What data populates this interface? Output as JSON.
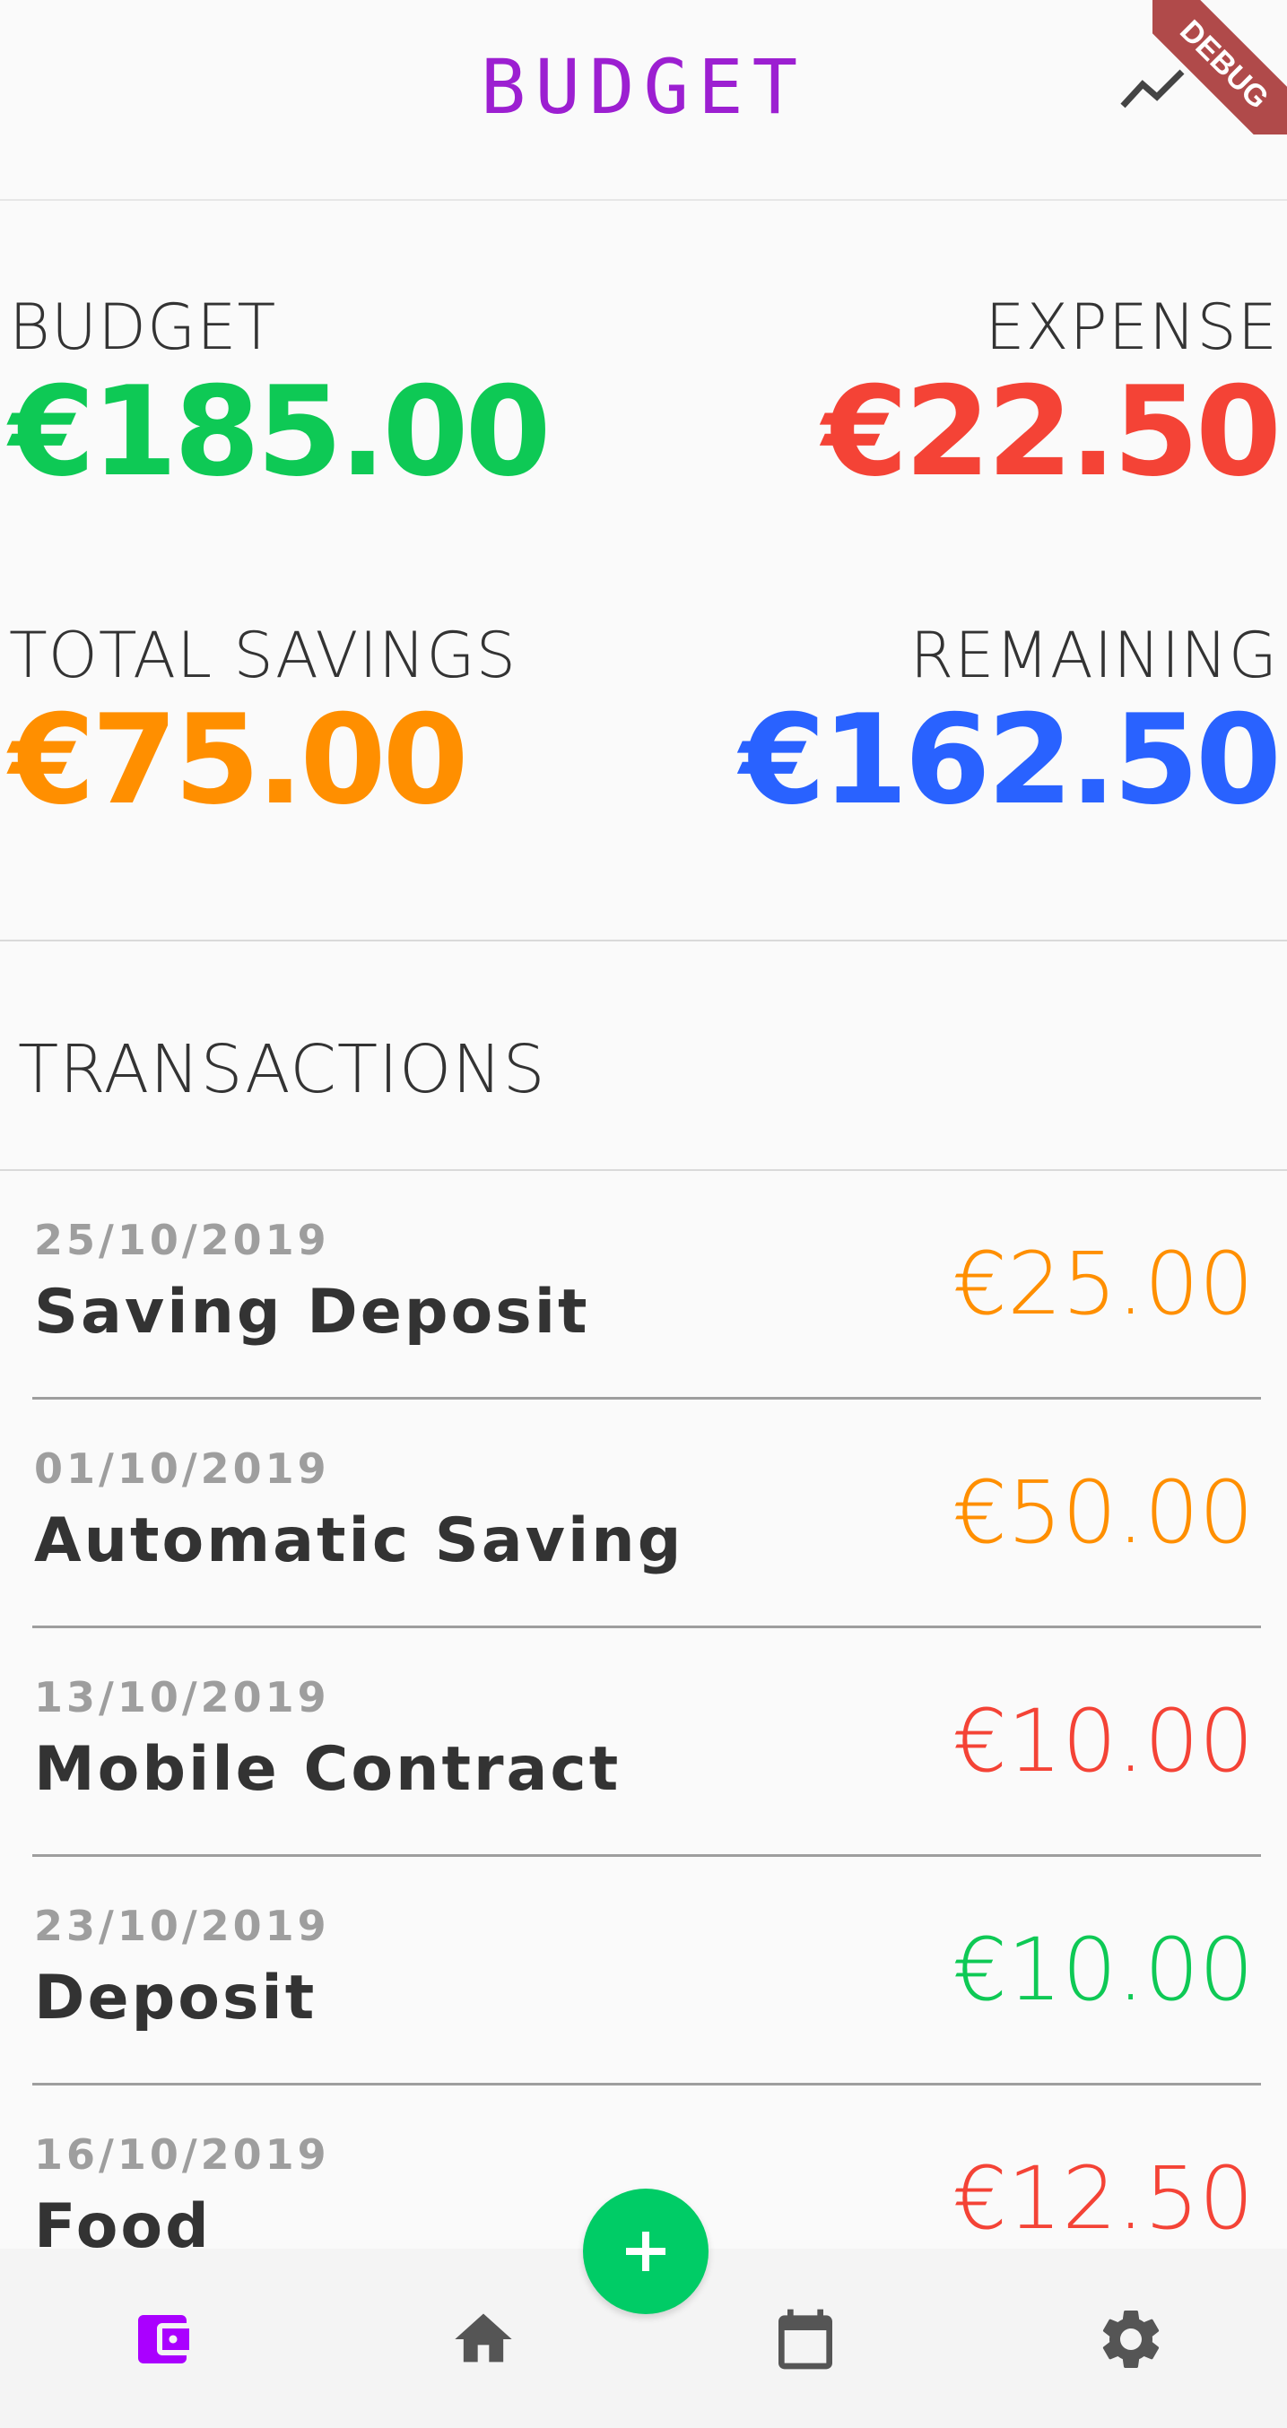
{
  "app_bar": {
    "title": "BUDGET",
    "debug_banner": "DEBUG",
    "chart_icon": "trending-icon"
  },
  "summary": {
    "budget": {
      "label": "BUDGET",
      "value": "€185.00",
      "color": "#0ec955"
    },
    "expense": {
      "label": "EXPENSE",
      "value": "€22.50",
      "color": "#f44336"
    },
    "savings": {
      "label": "TOTAL SAVINGS",
      "value": "€75.00",
      "color": "#ff8f00"
    },
    "remaining": {
      "label": "REMAINING",
      "value": "€162.50",
      "color": "#2962ff"
    }
  },
  "transactions": {
    "title": "TRANSACTIONS",
    "items": [
      {
        "date": "25/10/2019",
        "name": "Saving Deposit",
        "amount": "€25.00",
        "color": "#ff8f00"
      },
      {
        "date": "01/10/2019",
        "name": "Automatic Saving",
        "amount": "€50.00",
        "color": "#ff8f00"
      },
      {
        "date": "13/10/2019",
        "name": "Mobile Contract",
        "amount": "€10.00",
        "color": "#f44336"
      },
      {
        "date": "23/10/2019",
        "name": "Deposit",
        "amount": "€10.00",
        "color": "#0ec955"
      },
      {
        "date": "16/10/2019",
        "name": "Food",
        "amount": "€12.50",
        "color": "#f44336"
      }
    ]
  },
  "bottom_nav": {
    "items": [
      {
        "icon": "wallet-icon",
        "active": true,
        "color": "#aa00ff"
      },
      {
        "icon": "home-icon",
        "active": false,
        "color": "#555555"
      },
      {
        "icon": "calendar-icon",
        "active": false,
        "color": "#555555"
      },
      {
        "icon": "settings-icon",
        "active": false,
        "color": "#555555"
      }
    ],
    "fab_icon": "plus-icon",
    "fab_color": "#00cc66"
  }
}
